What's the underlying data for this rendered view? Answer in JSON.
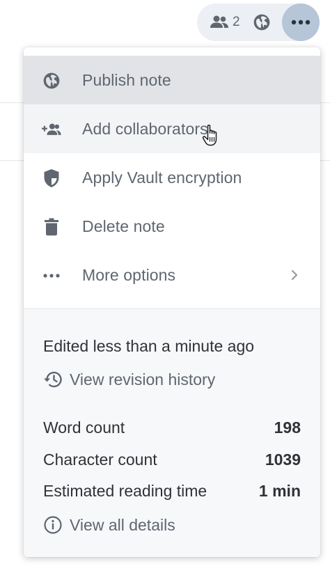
{
  "toolbar": {
    "collaborators_count": "2",
    "icons": [
      "people-icon",
      "globe-icon",
      "more-horizontal-icon"
    ],
    "more_button_color": "#b7c5d8"
  },
  "menu": {
    "items": [
      {
        "label": "Publish note",
        "icon": "globe-icon",
        "state": "active"
      },
      {
        "label": "Add collaborators",
        "icon": "add-person-icon",
        "state": "hover"
      },
      {
        "label": "Apply Vault encryption",
        "icon": "shield-icon"
      },
      {
        "label": "Delete note",
        "icon": "trash-icon"
      },
      {
        "label": "More options",
        "icon": "more-horizontal-icon",
        "has_submenu": true
      }
    ]
  },
  "details": {
    "edited": "Edited less than a minute ago",
    "revision_link": "View revision history",
    "stats": [
      {
        "label": "Word count",
        "value": "198"
      },
      {
        "label": "Character count",
        "value": "1039"
      },
      {
        "label": "Estimated reading time",
        "value": "1 min"
      }
    ],
    "all_details_link": "View all details"
  }
}
